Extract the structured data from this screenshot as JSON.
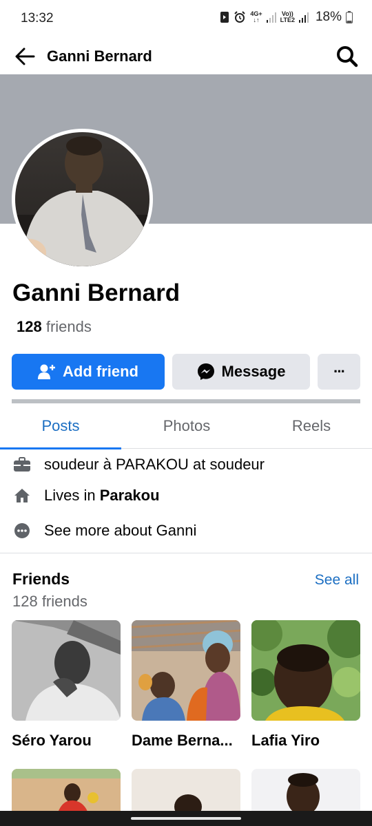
{
  "status_bar": {
    "time": "13:32",
    "net_label_top": "4G+",
    "volte_label": "Vo))",
    "lte2_label": "LTE2",
    "battery": "18%"
  },
  "header": {
    "title": "Ganni Bernard",
    "back_icon": "arrow-left-icon",
    "search_icon": "search-icon"
  },
  "profile": {
    "name": "Ganni Bernard",
    "friends_number": "128",
    "friends_word": "friends"
  },
  "actions": {
    "add_friend": "Add friend",
    "message": "Message",
    "more": "···"
  },
  "tabs": [
    "Posts",
    "Photos",
    "Reels"
  ],
  "intro": {
    "work": "soudeur à PARAKOU at soudeur",
    "lives_prefix": "Lives in ",
    "lives_city": "Parakou",
    "see_more": "See more about Ganni"
  },
  "friends_section": {
    "title": "Friends",
    "count": "128 friends",
    "see_all": "See all",
    "items": [
      {
        "name": "Séro Yarou"
      },
      {
        "name": "Dame Berna..."
      },
      {
        "name": "Lafia Yiro"
      }
    ]
  },
  "colors": {
    "accent": "#1877f2",
    "link": "#1b6ec2",
    "cover": "#a5a9b0",
    "button_secondary": "#e4e6eb"
  }
}
